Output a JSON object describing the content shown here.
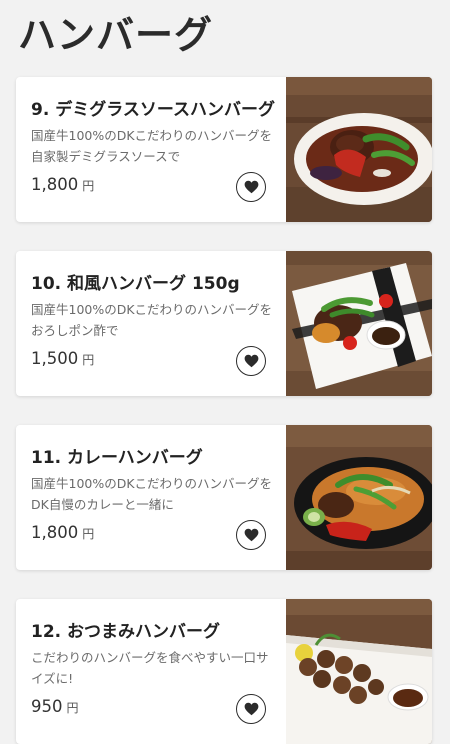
{
  "page": {
    "section_title": "ハンバーグ"
  },
  "menu_items": [
    {
      "title": "9. デミグラスソースハンバーグ",
      "description": "国産牛100%のDKこだわりのハンバーグを自家製デミグラスソースで",
      "price": "1,800",
      "currency": "円",
      "icon": "heart-icon"
    },
    {
      "title": "10. 和風ハンバーグ 150g",
      "description": "国産牛100%のDKこだわりのハンバーグをおろしポン酢で",
      "price": "1,500",
      "currency": "円",
      "icon": "heart-icon"
    },
    {
      "title": "11. カレーハンバーグ",
      "description": "国産牛100%のDKこだわりのハンバーグをDK自慢のカレーと一緒に",
      "price": "1,800",
      "currency": "円",
      "icon": "heart-icon"
    },
    {
      "title": "12. おつまみハンバーグ",
      "description": "こだわりのハンバーグを食べやすい一口サイズに!",
      "price": "950",
      "currency": "円",
      "icon": "heart-icon"
    }
  ]
}
